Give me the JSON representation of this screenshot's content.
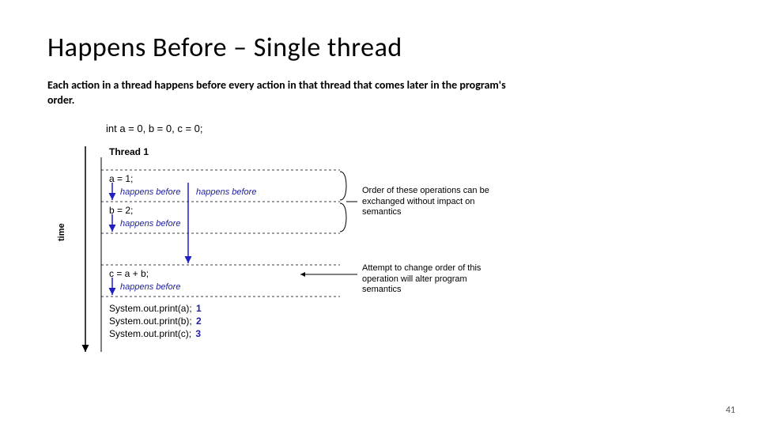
{
  "slide": {
    "title": "Happens Before – Single thread",
    "subtitle": "Each action in a thread happens before every action in that thread that comes later in the program's order.",
    "page_number": "41"
  },
  "diagram": {
    "time_axis_label": "time",
    "declaration": "int a = 0, b = 0, c = 0;",
    "thread_label": "Thread 1",
    "stmt1": "a = 1;",
    "stmt2": "b = 2;",
    "stmt3": "c = a + b;",
    "hb_label": "happens before",
    "annotation_reorder": "Order of these operations can be exchanged without impact on semantics",
    "annotation_fixed": "Attempt to change order of this operation will alter program semantics",
    "out1": "System.out.print(a);",
    "out2": "System.out.print(b);",
    "out3": "System.out.print(c);",
    "out1_result": "1",
    "out2_result": "2",
    "out3_result": "3"
  }
}
